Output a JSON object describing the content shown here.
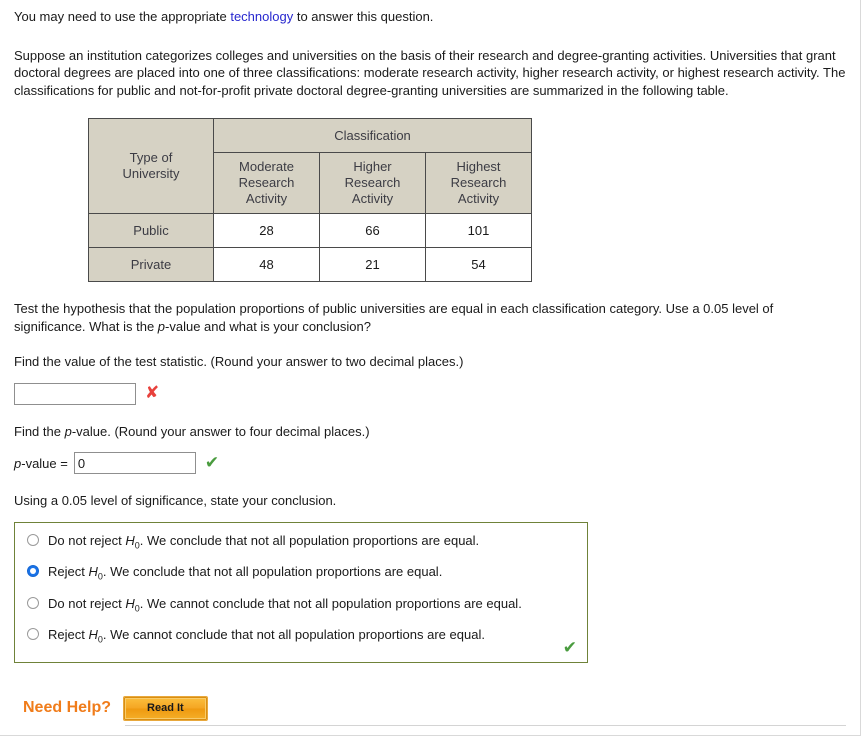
{
  "intro": {
    "before_link": "You may need to use the appropriate ",
    "link_text": "technology",
    "after_link": " to answer this question."
  },
  "problem": {
    "text": "Suppose an institution categorizes colleges and universities on the basis of their research and degree-granting activities. Universities that grant doctoral degrees are placed into one of three classifications: moderate research activity, higher research activity, or highest research activity. The classifications for public and not-for-profit private doctoral degree-granting universities are summarized in the following table."
  },
  "table": {
    "corner_label_line1": "Type of",
    "corner_label_line2": "University",
    "group_header": "Classification",
    "column_headers": [
      "Moderate Research Activity",
      "Higher Research Activity",
      "Highest Research Activity"
    ],
    "column_headers_lines": [
      [
        "Moderate",
        "Research",
        "Activity"
      ],
      [
        "Higher",
        "Research",
        "Activity"
      ],
      [
        "Highest",
        "Research",
        "Activity"
      ]
    ],
    "rows": [
      {
        "label": "Public",
        "values": [
          "28",
          "66",
          "101"
        ]
      },
      {
        "label": "Private",
        "values": [
          "48",
          "21",
          "54"
        ]
      }
    ]
  },
  "hypothesis_prompt": {
    "part1": "Test the hypothesis that the population proportions of public universities are equal in each classification category. Use a 0.05 level of significance. What is the ",
    "italic_p": "p",
    "part2": "-value and what is your conclusion?"
  },
  "test_statistic": {
    "prompt": "Find the value of the test statistic. (Round your answer to two decimal places.)",
    "value": "",
    "placeholder": "",
    "status_icon": "x-mark",
    "status_color": "#e8413c",
    "status_glyph": "✘"
  },
  "p_value": {
    "prompt_part1": "Find the ",
    "prompt_italic_p": "p",
    "prompt_part2": "-value. (Round your answer to four decimal places.)",
    "label_italic_p": "p",
    "label_rest": "-value =",
    "value": "0",
    "placeholder": "",
    "status_icon": "check-mark",
    "status_color": "#4a9c3f",
    "status_glyph": "✔"
  },
  "conclusion": {
    "prompt": "Using a 0.05 level of significance, state your conclusion.",
    "options": [
      {
        "id": "option-1",
        "prefix": "Do not reject ",
        "symbol": "H",
        "subscript": "0",
        "suffix": ". We conclude that not all population proportions are equal.",
        "selected": false
      },
      {
        "id": "option-2",
        "prefix": "Reject ",
        "symbol": "H",
        "subscript": "0",
        "suffix": ". We conclude that not all population proportions are equal.",
        "selected": true
      },
      {
        "id": "option-3",
        "prefix": "Do not reject ",
        "symbol": "H",
        "subscript": "0",
        "suffix": ". We cannot conclude that not all population proportions are equal.",
        "selected": false
      },
      {
        "id": "option-4",
        "prefix": "Reject ",
        "symbol": "H",
        "subscript": "0",
        "suffix": ". We cannot conclude that not all population proportions are equal.",
        "selected": false
      }
    ],
    "status_glyph": "✔",
    "status_color": "#4a9c3f",
    "border_color": "#6f8239"
  },
  "help": {
    "label": "Need Help?",
    "button_label": "Read It",
    "label_color": "#f07c1a"
  }
}
